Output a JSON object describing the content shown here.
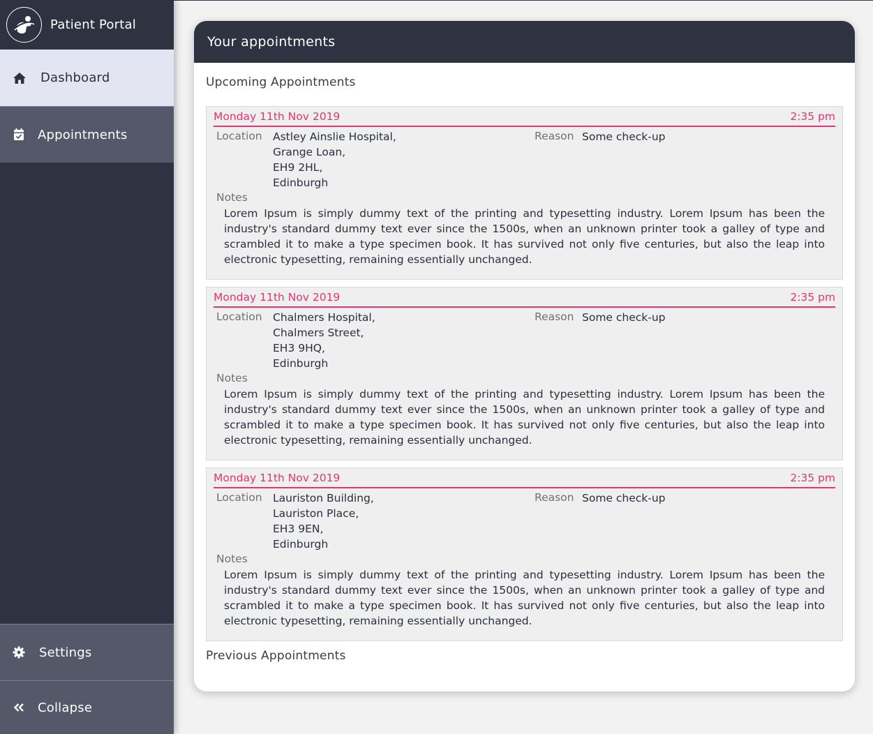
{
  "app": {
    "title": "Patient Portal"
  },
  "sidebar": {
    "items": [
      {
        "label": "Dashboard",
        "icon": "home-icon"
      },
      {
        "label": "Appointments",
        "icon": "calendar-check-icon"
      }
    ],
    "settings_label": "Settings",
    "collapse_label": "Collapse"
  },
  "main": {
    "header": "Your appointments",
    "upcoming_title": "Upcoming Appointments",
    "previous_title": "Previous Appointments",
    "labels": {
      "location": "Location",
      "reason": "Reason",
      "notes": "Notes"
    },
    "appointments": [
      {
        "date": "Monday 11th Nov 2019",
        "time": "2:35 pm",
        "location": [
          "Astley Ainslie Hospital,",
          "Grange Loan,",
          "EH9 2HL,",
          "Edinburgh"
        ],
        "reason": "Some check-up",
        "notes": "Lorem Ipsum is simply dummy text of the printing and typesetting industry. Lorem Ipsum has been the industry's standard dummy text ever since the 1500s, when an unknown printer took a galley of type and scrambled it to make a type specimen book. It has survived not only five centuries, but also the leap into electronic typesetting, remaining essentially unchanged."
      },
      {
        "date": "Monday 11th Nov 2019",
        "time": "2:35 pm",
        "location": [
          "Chalmers Hospital,",
          "Chalmers Street,",
          "EH3 9HQ,",
          "Edinburgh"
        ],
        "reason": "Some check-up",
        "notes": "Lorem Ipsum is simply dummy text of the printing and typesetting industry. Lorem Ipsum has been the industry's standard dummy text ever since the 1500s, when an unknown printer took a galley of type and scrambled it to make a type specimen book. It has survived not only five centuries, but also the leap into electronic typesetting, remaining essentially unchanged."
      },
      {
        "date": "Monday 11th Nov 2019",
        "time": "2:35 pm",
        "location": [
          "Lauriston Building,",
          "Lauriston Place,",
          "EH3 9EN,",
          "Edinburgh"
        ],
        "reason": "Some check-up",
        "notes": "Lorem Ipsum is simply dummy text of the printing and typesetting industry. Lorem Ipsum has been the industry's standard dummy text ever since the 1500s, when an unknown printer took a galley of type and scrambled it to make a type specimen book. It has survived not only five centuries, but also the leap into electronic typesetting, remaining essentially unchanged."
      }
    ]
  },
  "colors": {
    "sidebar": "#2f3241",
    "active": "#e3e5f2",
    "accent": "#e8336e",
    "card_bg": "#efefef"
  }
}
